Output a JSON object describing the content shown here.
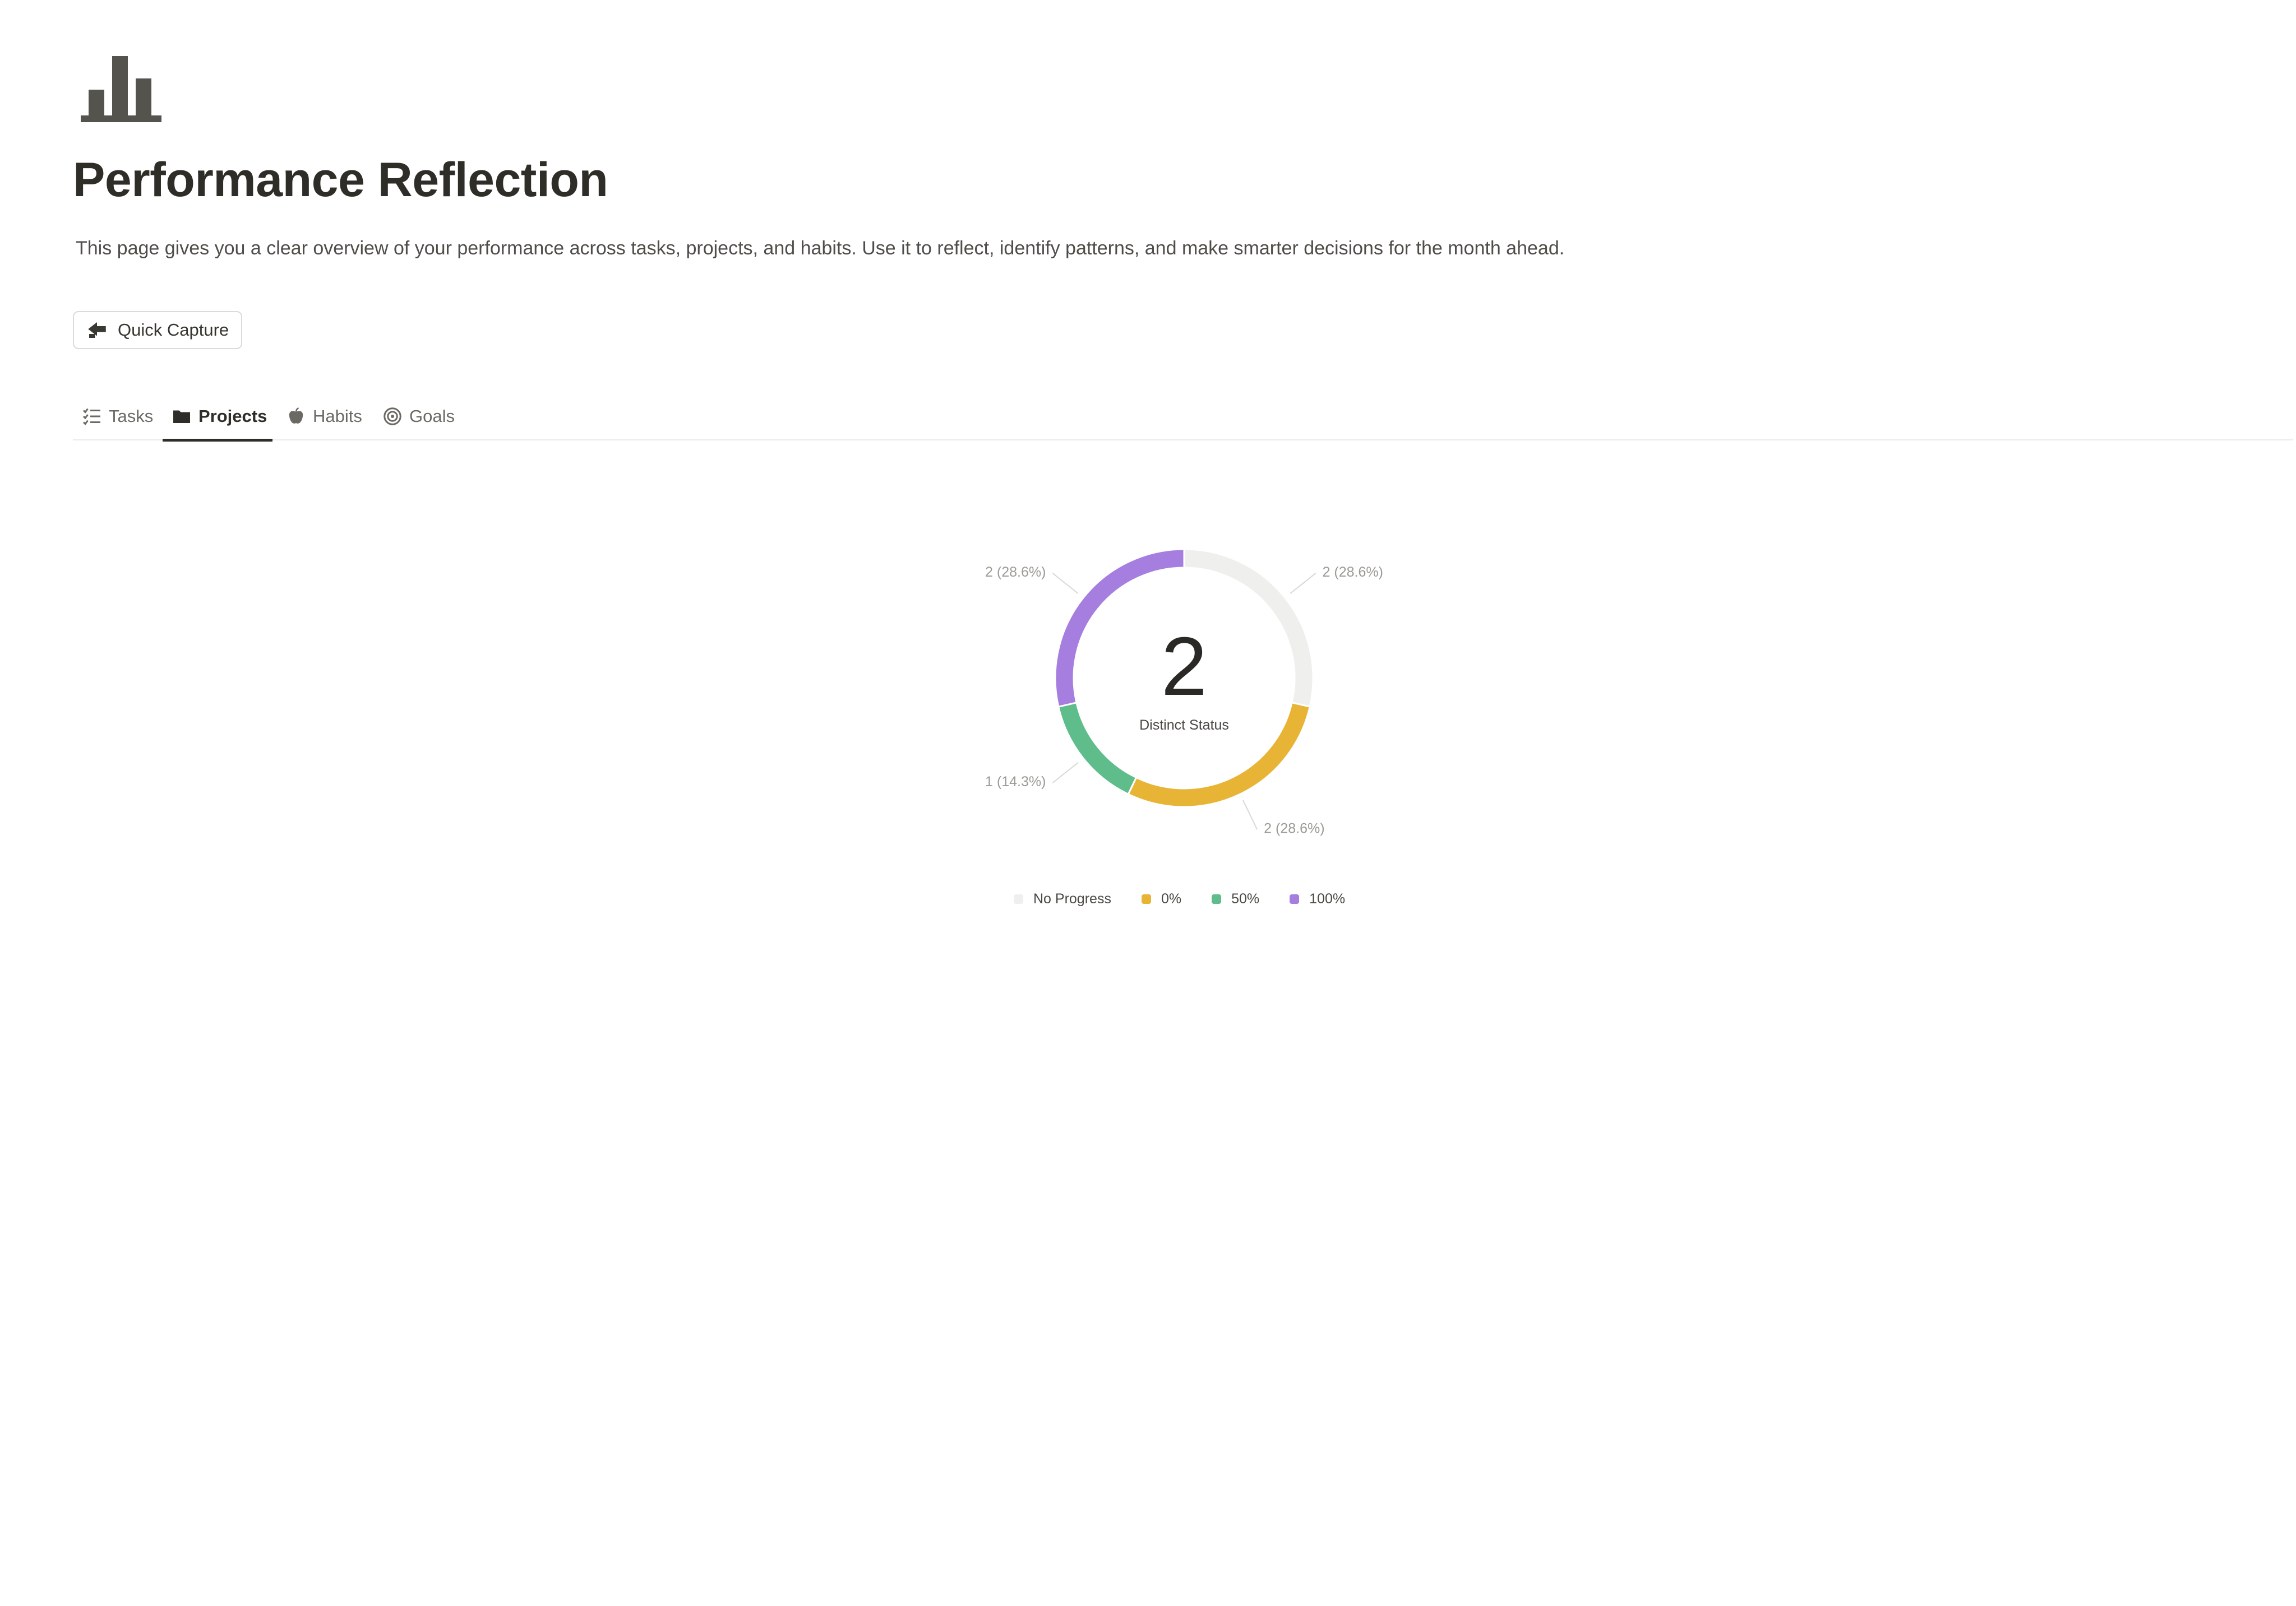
{
  "page": {
    "icon": "bar-chart-icon",
    "title": "Performance Reflection",
    "description": "This page gives you a clear overview of your performance across tasks, projects, and habits. Use it to reflect, identify patterns, and make smarter decisions for the month ahead."
  },
  "quick_capture": {
    "label": "Quick Capture",
    "icon": "paper-plane-arrow-icon"
  },
  "tabs": [
    {
      "label": "Tasks",
      "icon": "checklist-icon",
      "active": false
    },
    {
      "label": "Projects",
      "icon": "folder-icon",
      "active": true
    },
    {
      "label": "Habits",
      "icon": "apple-icon",
      "active": false
    },
    {
      "label": "Goals",
      "icon": "target-icon",
      "active": false
    }
  ],
  "chart_data": {
    "type": "pie",
    "style": "donut",
    "center_value": "2",
    "center_label": "Distinct Status",
    "categories": [
      "No Progress",
      "0%",
      "50%",
      "100%"
    ],
    "values": [
      2,
      2,
      1,
      2
    ],
    "slice_labels": [
      "2 (28.6%)",
      "2 (28.6%)",
      "1 (14.3%)",
      "2 (28.6%)"
    ],
    "colors": [
      "#efefed",
      "#e8b436",
      "#5ebd8a",
      "#a57ee0"
    ],
    "legend_position": "bottom"
  }
}
